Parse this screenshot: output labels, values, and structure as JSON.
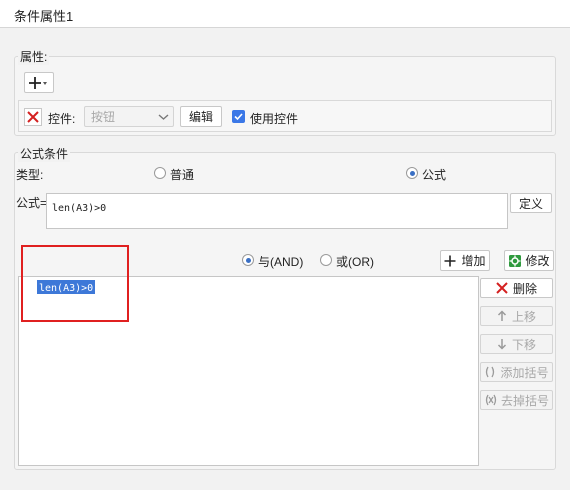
{
  "window": {
    "title": "条件属性1"
  },
  "properties": {
    "section_label": "属性:",
    "control_label": "控件:",
    "control_select_value": "按钮",
    "edit_button": "编辑",
    "use_control_label": "使用控件"
  },
  "formula_condition": {
    "section_label": "公式条件",
    "type_label": "类型:",
    "type_normal": "普通",
    "type_formula": "公式",
    "formula_label": "公式=",
    "formula_value": "len(A3)>0",
    "define_button": "定义"
  },
  "condition_list": {
    "and_label": "与(AND)",
    "or_label": "或(OR)",
    "add_button": "增加",
    "modify_button": "修改",
    "items": [
      "len(A3)>0"
    ],
    "delete_button": "删除",
    "move_up_button": "上移",
    "move_down_button": "下移",
    "add_paren_button": "添加括号",
    "remove_paren_button": "去掉括号"
  },
  "colors": {
    "highlight": "#3d78d8",
    "annotation_box": "#e02020",
    "delete_icon": "#d42020",
    "checkbox": "#3b78e7"
  }
}
